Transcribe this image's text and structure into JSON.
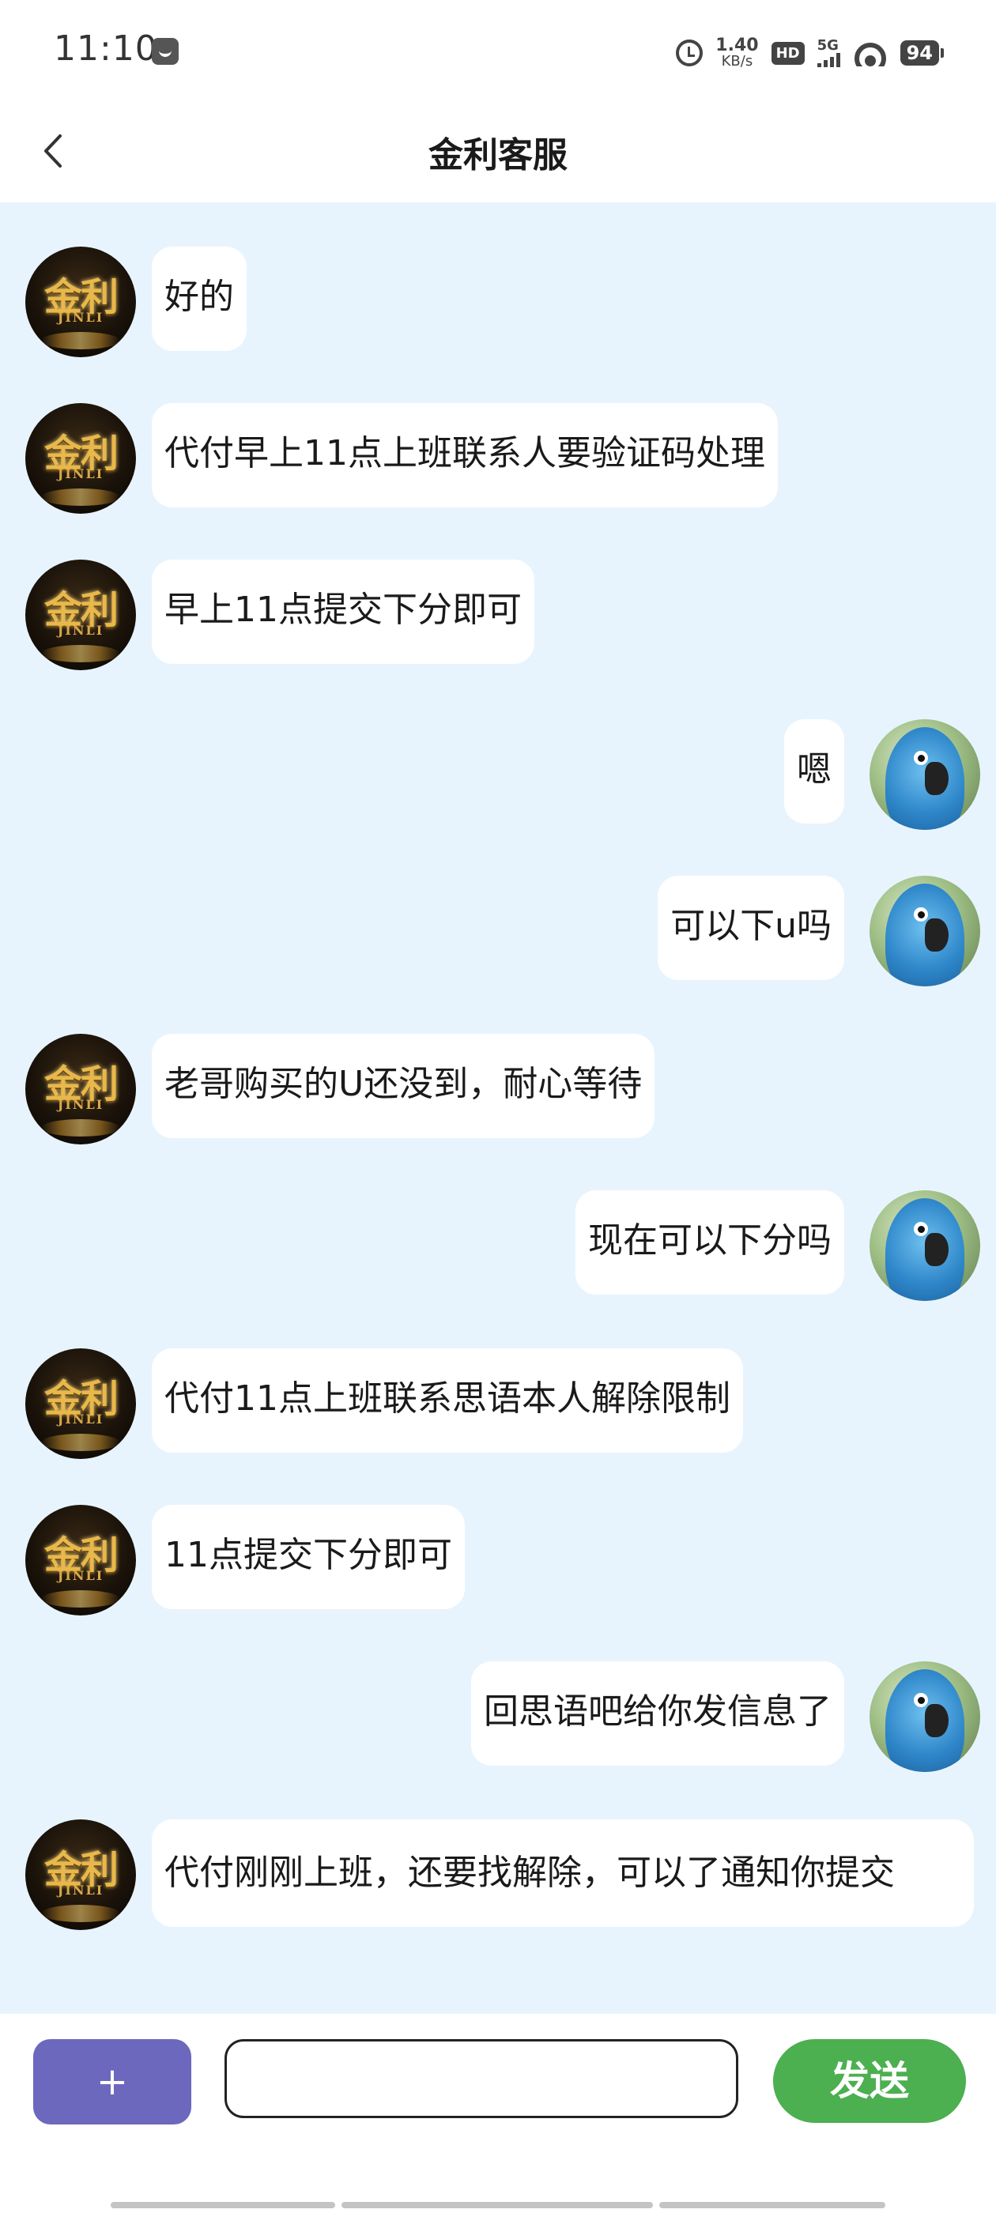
{
  "status_bar": {
    "time": "11:10",
    "net_speed_value": "1.40",
    "net_speed_unit": "KB/s",
    "hd_label": "HD",
    "network_label": "5G",
    "battery": "94"
  },
  "header": {
    "title": "金利客服"
  },
  "avatars": {
    "support_logo_text": "金利",
    "support_logo_sub": "JINLI"
  },
  "messages": [
    {
      "side": "left",
      "text": "好的"
    },
    {
      "side": "left",
      "text": "代付早上11点上班联系人要验证码处理"
    },
    {
      "side": "left",
      "text": "早上11点提交下分即可"
    },
    {
      "side": "right",
      "text": "嗯"
    },
    {
      "side": "right",
      "text": "可以下u吗"
    },
    {
      "side": "left",
      "text": "老哥购买的U还没到，耐心等待"
    },
    {
      "side": "right",
      "text": "现在可以下分吗"
    },
    {
      "side": "left",
      "text": "代付11点上班联系思语本人解除限制"
    },
    {
      "side": "left",
      "text": "11点提交下分即可"
    },
    {
      "side": "right",
      "text": "回思语吧给你发信息了"
    },
    {
      "side": "left",
      "text": "代付刚刚上班，还要找解除，可以了通知你提交"
    }
  ],
  "input_bar": {
    "plus_label": "+",
    "input_value": "",
    "send_label": "发送"
  },
  "colors": {
    "chat_background": "#e8f4fd",
    "plus_button": "#6c68bd",
    "send_button": "#4caf50"
  }
}
